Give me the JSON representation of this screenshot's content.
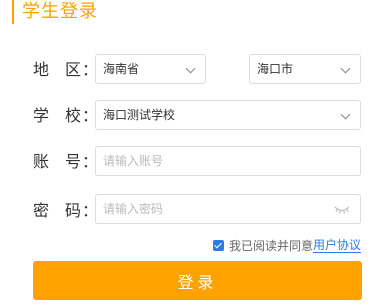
{
  "header": {
    "title": "学生登录"
  },
  "region": {
    "label_a": "地",
    "label_b": "区：",
    "province": "海南省",
    "city": "海口市"
  },
  "school": {
    "label_a": "学",
    "label_b": "校：",
    "value": "海口测试学校"
  },
  "account": {
    "label_a": "账",
    "label_b": "号：",
    "placeholder": "请输入账号"
  },
  "password": {
    "label_a": "密",
    "label_b": "码：",
    "placeholder": "请输入密码"
  },
  "agreement": {
    "checked": true,
    "text": "我已阅读并同意",
    "link": "用户协议"
  },
  "login": {
    "label": "登录"
  },
  "colors": {
    "accent": "#ffa200",
    "link": "#2d7be5",
    "border": "#dcdcdc"
  }
}
